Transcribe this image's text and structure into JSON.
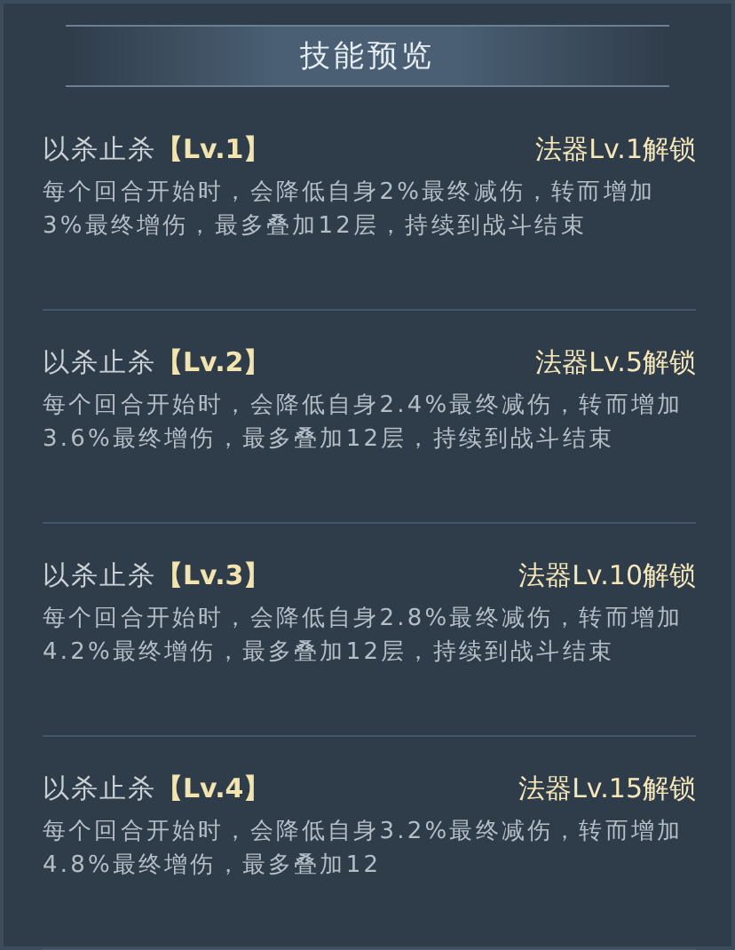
{
  "title": "技能预览",
  "skills": [
    {
      "name": "以杀止杀",
      "level": "【Lv.1】",
      "unlock": "法器Lv.1解锁",
      "description": "每个回合开始时，会降低自身2%最终减伤，转而增加3%最终增伤，最多叠加12层，持续到战斗结束"
    },
    {
      "name": "以杀止杀",
      "level": "【Lv.2】",
      "unlock": "法器Lv.5解锁",
      "description": "每个回合开始时，会降低自身2.4%最终减伤，转而增加3.6%最终增伤，最多叠加12层，持续到战斗结束"
    },
    {
      "name": "以杀止杀",
      "level": "【Lv.3】",
      "unlock": "法器Lv.10解锁",
      "description": "每个回合开始时，会降低自身2.8%最终减伤，转而增加4.2%最终增伤，最多叠加12层，持续到战斗结束"
    },
    {
      "name": "以杀止杀",
      "level": "【Lv.4】",
      "unlock": "法器Lv.15解锁",
      "description": "每个回合开始时，会降低自身3.2%最终减伤，转而增加4.8%最终增伤，最多叠加12"
    }
  ]
}
